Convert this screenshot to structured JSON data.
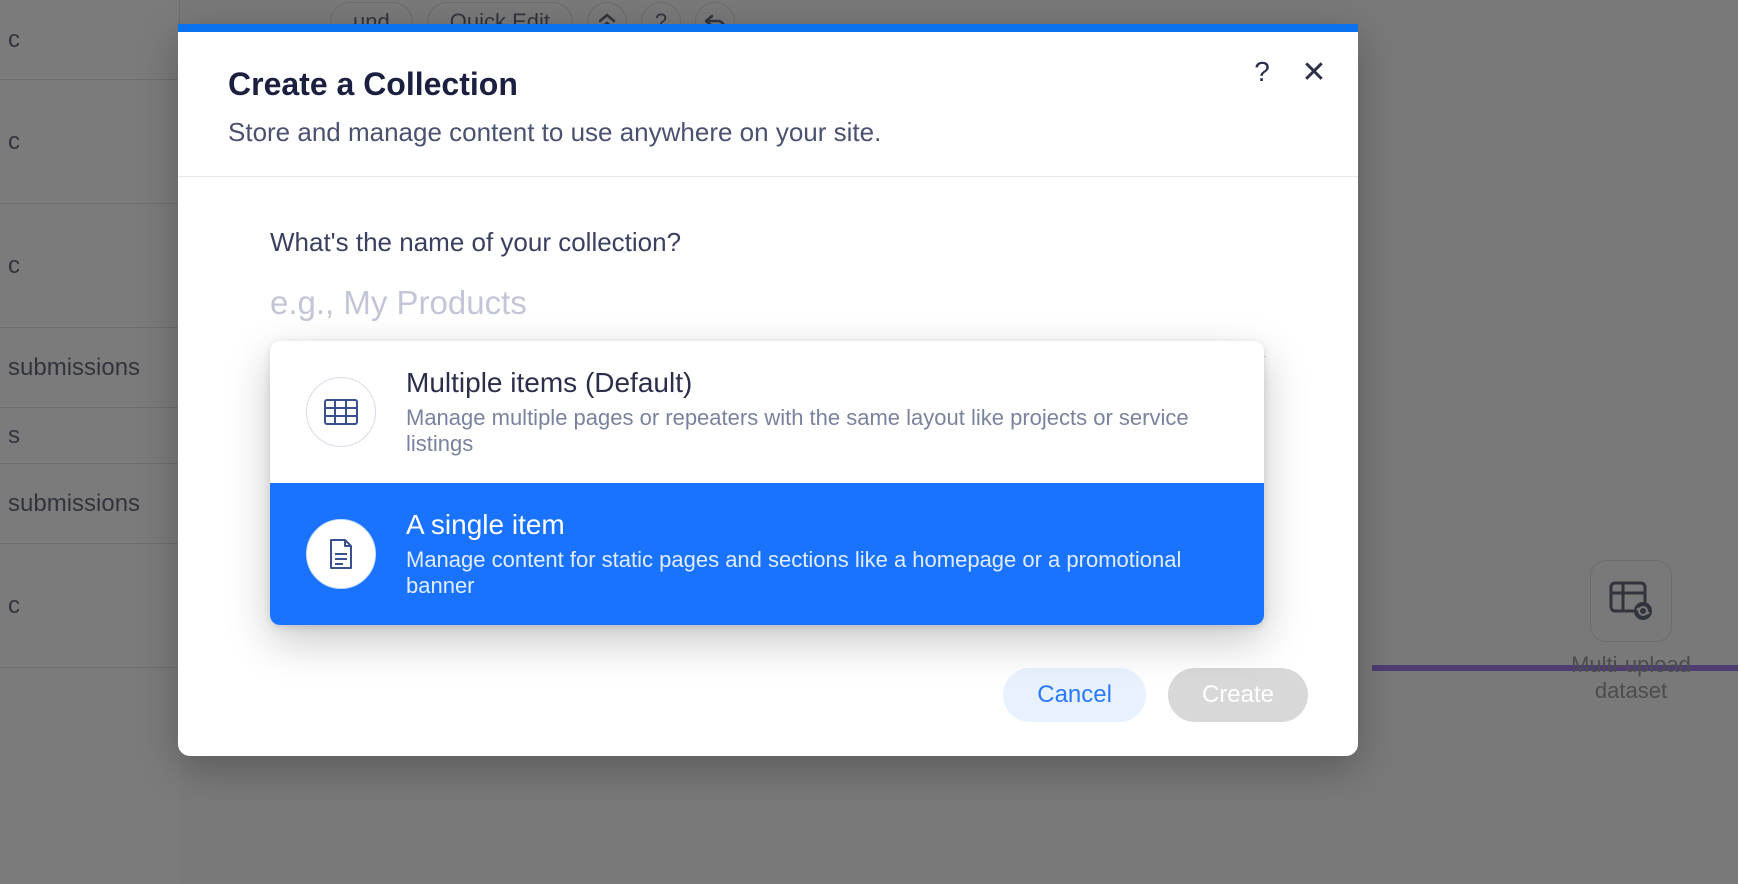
{
  "background": {
    "sidebar_rows": [
      "c",
      "c",
      "c",
      "submissions",
      "s",
      "submissions",
      "c"
    ],
    "toolbar": {
      "pill1": "und",
      "pill2": "Quick Edit"
    },
    "float_button_label": "Multi-upload\ndataset"
  },
  "modal": {
    "title": "Create a Collection",
    "subtitle": "Store and manage content to use anywhere on your site.",
    "question": "What's the name of your collection?",
    "placeholder": "e.g., My Products",
    "options": [
      {
        "title": "Multiple items (Default)",
        "desc": "Manage multiple pages or repeaters with the same layout like projects or service listings",
        "selected": false
      },
      {
        "title": "A single item",
        "desc": "Manage content for static pages and sections like a homepage or a promotional banner",
        "selected": true
      }
    ],
    "cancel": "Cancel",
    "create": "Create"
  }
}
